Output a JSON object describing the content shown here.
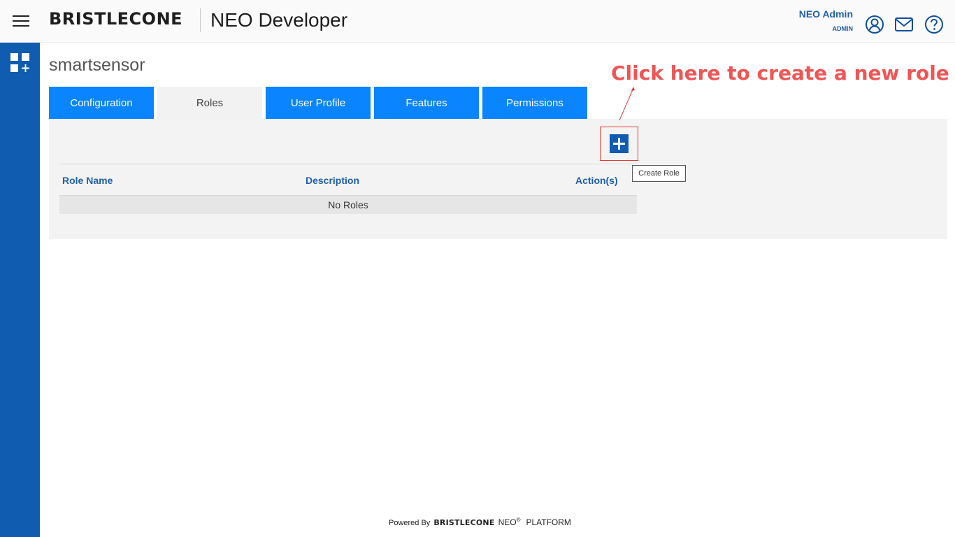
{
  "header": {
    "logo": "BRISTLECONE",
    "app_title": "NEO Developer",
    "user_name": "NEO Admin",
    "user_role": "ADMIN",
    "icons": [
      "menu-icon",
      "user-icon",
      "mail-icon",
      "help-icon"
    ]
  },
  "sidebar": {
    "icons": [
      "apps-add-icon"
    ]
  },
  "main": {
    "project_title": "smartsensor",
    "tabs": [
      {
        "label": "Configuration"
      },
      {
        "label": "Roles"
      },
      {
        "label": "User Profile"
      },
      {
        "label": "Features"
      },
      {
        "label": "Permissions"
      }
    ],
    "active_tab": "Roles",
    "create_role_tooltip": "Create Role",
    "annotation": "Click here to create a new role",
    "table": {
      "columns": [
        "Role Name",
        "Description",
        "Action(s)"
      ],
      "empty_text": "No Roles"
    }
  },
  "footer": {
    "powered_by": "Powered By",
    "brand": "BRISTLECONE",
    "product": "NEO",
    "registered": "®",
    "platform": "PLATFORM"
  },
  "colors": {
    "primary_blue": "#0a84ff",
    "sidebar_blue": "#0f5cb0",
    "annotation_red": "#f05454",
    "header_text_blue": "#1f5fa8"
  }
}
